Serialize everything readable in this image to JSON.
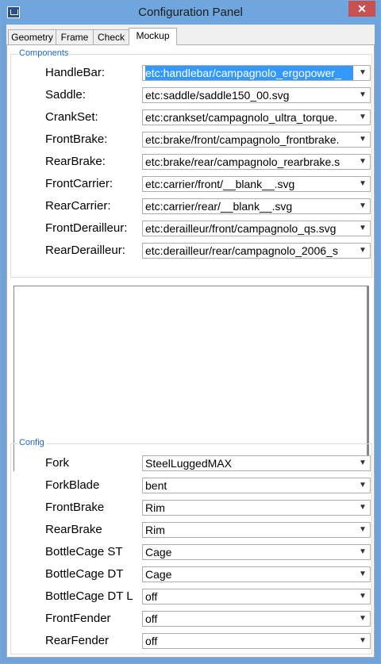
{
  "window": {
    "title": "Configuration Panel",
    "close_label": "✕"
  },
  "tabs": [
    {
      "label": "Geometry",
      "active": false
    },
    {
      "label": "Frame",
      "active": false
    },
    {
      "label": "Check",
      "active": false
    },
    {
      "label": "Mockup",
      "active": true
    }
  ],
  "components": {
    "legend": "Components",
    "rows": [
      {
        "label": "HandleBar:",
        "value": "etc:handlebar/campagnolo_ergopower_"
      },
      {
        "label": "Saddle:",
        "value": "etc:saddle/saddle150_00.svg"
      },
      {
        "label": "CrankSet:",
        "value": "etc:crankset/campagnolo_ultra_torque."
      },
      {
        "label": "FrontBrake:",
        "value": "etc:brake/front/campagnolo_frontbrake."
      },
      {
        "label": "RearBrake:",
        "value": "etc:brake/rear/campagnolo_rearbrake.s"
      },
      {
        "label": "FrontCarrier:",
        "value": "etc:carrier/front/__blank__.svg"
      },
      {
        "label": "RearCarrier:",
        "value": "etc:carrier/rear/__blank__.svg"
      },
      {
        "label": "FrontDerailleur:",
        "value": "etc:derailleur/front/campagnolo_qs.svg"
      },
      {
        "label": "RearDerailleur:",
        "value": "etc:derailleur/rear/campagnolo_2006_s"
      }
    ]
  },
  "config": {
    "legend": "Config",
    "rows": [
      {
        "label": "Fork",
        "value": "SteelLuggedMAX"
      },
      {
        "label": "ForkBlade",
        "value": "bent"
      },
      {
        "label": "FrontBrake",
        "value": "Rim"
      },
      {
        "label": "RearBrake",
        "value": "Rim"
      },
      {
        "label": "BottleCage ST",
        "value": "Cage"
      },
      {
        "label": "BottleCage DT",
        "value": "Cage"
      },
      {
        "label": "BottleCage DT L",
        "value": "off"
      },
      {
        "label": "FrontFender",
        "value": "off"
      },
      {
        "label": "RearFender",
        "value": "off"
      }
    ]
  }
}
